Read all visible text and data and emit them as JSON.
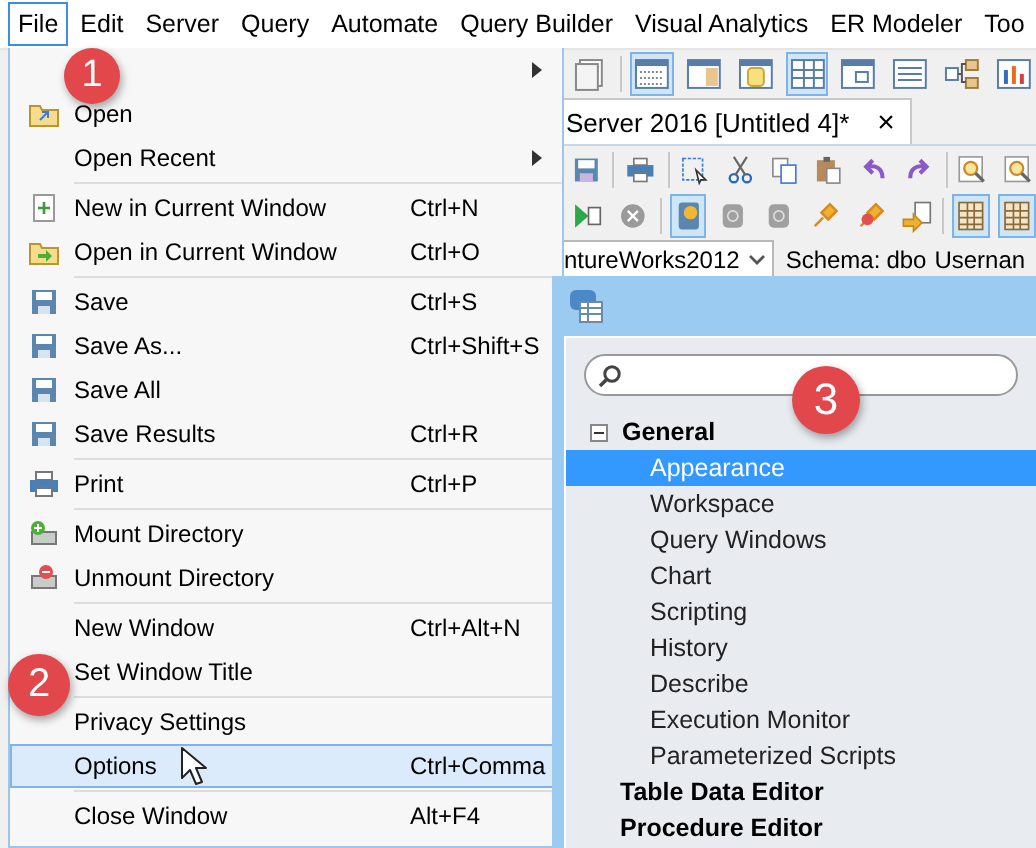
{
  "menu_bar": [
    {
      "label": "File",
      "selected": true
    },
    {
      "label": "Edit",
      "selected": false
    },
    {
      "label": "Server",
      "selected": false
    },
    {
      "label": "Query",
      "selected": false
    },
    {
      "label": "Automate",
      "selected": false
    },
    {
      "label": "Query Builder",
      "selected": false
    },
    {
      "label": "Visual Analytics",
      "selected": false
    },
    {
      "label": "ER Modeler",
      "selected": false
    },
    {
      "label": "Too",
      "selected": false
    }
  ],
  "editor_tab": {
    "title": "Server 2016 [Untitled 4]*",
    "close": "×"
  },
  "connection_bar": {
    "database": "ntureWorks2012",
    "schema_label": "Schema:",
    "schema": "dbo",
    "username_label": "Usernan"
  },
  "file_menu": [
    {
      "kind": "item",
      "submenu": true,
      "selected": false
    },
    {
      "kind": "item",
      "label": "Open",
      "selected": false
    },
    {
      "kind": "item",
      "label": "Open Recent",
      "submenu": true,
      "selected": false
    },
    {
      "kind": "separator"
    },
    {
      "kind": "item",
      "label": "New in Current Window",
      "shortcut": "Ctrl+N",
      "selected": false
    },
    {
      "kind": "item",
      "label": "Open in Current Window",
      "shortcut": "Ctrl+O",
      "selected": false
    },
    {
      "kind": "separator"
    },
    {
      "kind": "item",
      "label": "Save",
      "shortcut": "Ctrl+S",
      "selected": false
    },
    {
      "kind": "item",
      "label": "Save As...",
      "shortcut": "Ctrl+Shift+S",
      "selected": false
    },
    {
      "kind": "item",
      "label": "Save All",
      "selected": false
    },
    {
      "kind": "item",
      "label": "Save Results",
      "shortcut": "Ctrl+R",
      "selected": false
    },
    {
      "kind": "separator"
    },
    {
      "kind": "item",
      "label": "Print",
      "shortcut": "Ctrl+P",
      "selected": false
    },
    {
      "kind": "separator"
    },
    {
      "kind": "item",
      "label": "Mount Directory",
      "selected": false
    },
    {
      "kind": "item",
      "label": "Unmount Directory",
      "selected": false
    },
    {
      "kind": "separator"
    },
    {
      "kind": "item",
      "label": "New Window",
      "shortcut": "Ctrl+Alt+N",
      "selected": false
    },
    {
      "kind": "item",
      "label": "Set Window Title",
      "selected": false
    },
    {
      "kind": "separator"
    },
    {
      "kind": "item",
      "label": "Privacy Settings",
      "selected": false
    },
    {
      "kind": "item",
      "label": "Options",
      "shortcut": "Ctrl+Comma",
      "selected": true
    },
    {
      "kind": "separator"
    },
    {
      "kind": "item",
      "label": "Close Window",
      "shortcut": "Alt+F4",
      "selected": false
    }
  ],
  "options_panel": {
    "tree": [
      {
        "label": "General",
        "expanded": true,
        "selected": false,
        "children": [
          {
            "label": "Appearance",
            "selected": true
          },
          {
            "label": "Workspace",
            "selected": false
          },
          {
            "label": "Query Windows",
            "selected": false
          },
          {
            "label": "Chart",
            "selected": false
          },
          {
            "label": "Scripting",
            "selected": false
          },
          {
            "label": "History",
            "selected": false
          },
          {
            "label": "Describe",
            "selected": false
          },
          {
            "label": "Execution Monitor",
            "selected": false
          },
          {
            "label": "Parameterized Scripts",
            "selected": false
          }
        ]
      },
      {
        "label": "Table Data Editor",
        "selected": false
      },
      {
        "label": "Procedure Editor",
        "selected": false
      }
    ]
  },
  "callouts": [
    "1",
    "2",
    "3"
  ]
}
